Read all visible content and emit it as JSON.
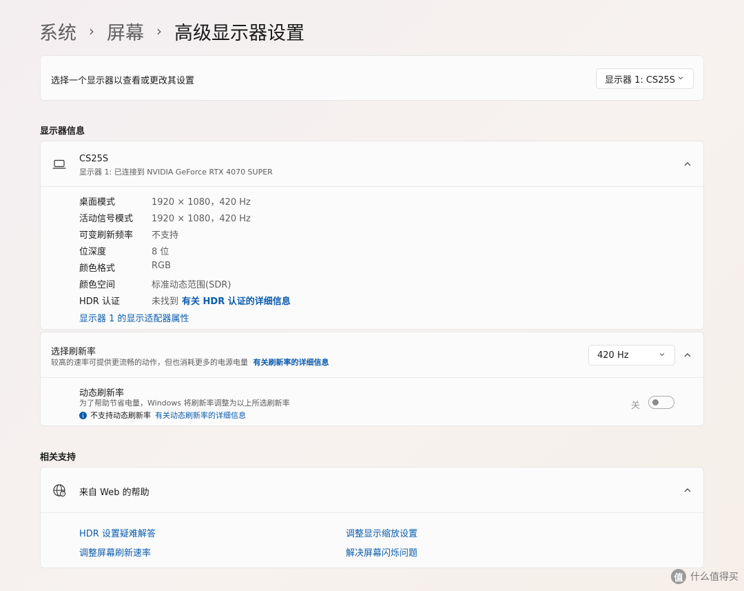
{
  "breadcrumb": [
    "系统",
    "屏幕",
    "高级显示器设置"
  ],
  "breadcrumb_sep": "›",
  "display_select": {
    "label": "选择一个显示器以查看或更改其设置",
    "value": "显示器 1: CS25S"
  },
  "display_info": {
    "section_title": "显示器信息",
    "name": "CS25S",
    "subtitle": "显示器 1: 已连接到 NVIDIA GeForce RTX 4070 SUPER",
    "rows": [
      {
        "key": "桌面模式",
        "value": "1920 × 1080，420 Hz"
      },
      {
        "key": "活动信号模式",
        "value": "1920 × 1080，420 Hz"
      },
      {
        "key": "可变刷新频率",
        "value": "不支持"
      },
      {
        "key": "位深度",
        "value": "8 位"
      },
      {
        "key": "颜色格式",
        "value": "RGB"
      },
      {
        "key": "颜色空间",
        "value": "标准动态范围(SDR)"
      }
    ],
    "hdr_key": "HDR 认证",
    "hdr_value": "未找到",
    "hdr_link": "有关 HDR 认证的详细信息",
    "adapter_link": "显示器 1 的显示适配器属性"
  },
  "refresh": {
    "title": "选择刷新率",
    "desc": "较高的速率可提供更流畅的动作，但也消耗更多的电源电量",
    "desc_link": "有关刷新率的详细信息",
    "value": "420 Hz",
    "dynamic_title": "动态刷新率",
    "dynamic_desc": "为了帮助节省电量，Windows 将刷新率调整为以上所选刷新率",
    "dynamic_note": "不支持动态刷新率",
    "dynamic_note_link": "有关动态刷新率的详细信息",
    "toggle_label": "关",
    "toggle_on": false
  },
  "support": {
    "section_title": "相关支持",
    "web_help": "来自 Web 的帮助",
    "links": [
      "HDR 设置疑难解答",
      "调整显示缩放设置",
      "调整屏幕刷新速率",
      "解决屏幕闪烁问题"
    ]
  },
  "watermark": {
    "badge": "值",
    "text": "什么值得买"
  },
  "colors": {
    "accent": "#0b5cad",
    "background": "#f5f0ee",
    "card": "#fbfbfb"
  }
}
